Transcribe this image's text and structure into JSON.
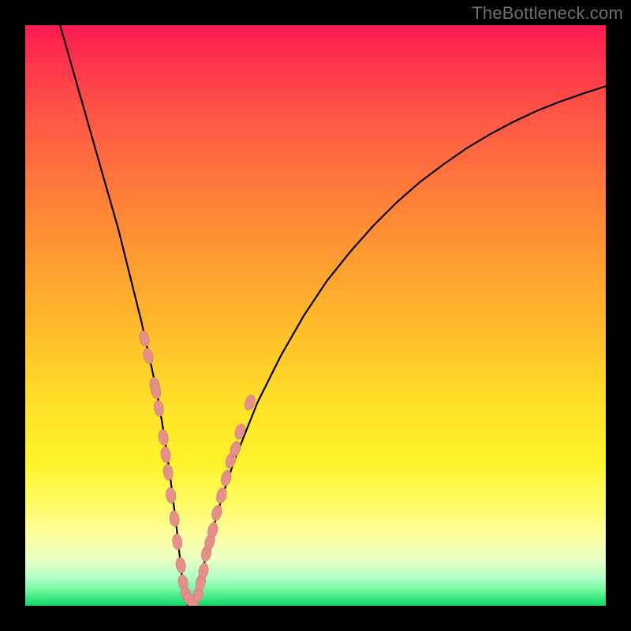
{
  "watermark": "TheBottleneck.com",
  "colors": {
    "frame": "#000000",
    "curve": "#000000",
    "marker_fill": "#e78f8a",
    "marker_stroke": "#c97a75"
  },
  "chart_data": {
    "type": "line",
    "title": "",
    "xlabel": "",
    "ylabel": "",
    "xlim": [
      0,
      100
    ],
    "ylim": [
      0,
      100
    ],
    "grid": false,
    "legend": false,
    "series": [
      {
        "name": "bottleneck-curve",
        "type": "line",
        "x": [
          6,
          8,
          10,
          12,
          14,
          16,
          18,
          20,
          22,
          23,
          24,
          25,
          26,
          27,
          28,
          29,
          30,
          32,
          34,
          36,
          38,
          40,
          44,
          48,
          52,
          56,
          60,
          64,
          68,
          72,
          76,
          80,
          84,
          88,
          92,
          96,
          100
        ],
        "y": [
          100,
          93,
          86,
          79,
          72,
          65,
          57,
          49,
          40,
          35,
          29,
          22,
          14,
          5,
          0,
          0,
          4,
          12,
          19,
          25,
          30,
          35,
          43,
          50,
          56,
          61,
          65.5,
          69.5,
          73,
          76,
          78.8,
          81.2,
          83.3,
          85.2,
          86.8,
          88.2,
          89.5
        ]
      },
      {
        "name": "measured-points-left",
        "type": "scatter",
        "x": [
          20.5,
          21.2,
          22.3,
          22.5,
          23.0,
          23.8,
          24.2,
          24.6,
          25.1,
          25.7,
          26.2,
          26.8,
          27.2,
          27.7,
          28.3,
          29.0
        ],
        "y": [
          46,
          43,
          38,
          37,
          34,
          29,
          26,
          23,
          19,
          15,
          11,
          7,
          4,
          2,
          1,
          0
        ]
      },
      {
        "name": "measured-points-right",
        "type": "scatter",
        "x": [
          29.8,
          30.2,
          30.7,
          31.2,
          31.8,
          32.3,
          33.0,
          33.8,
          34.6,
          35.4,
          36.2,
          37.0,
          38.7
        ],
        "y": [
          2,
          4,
          6,
          9,
          11,
          13,
          16,
          19,
          22,
          25,
          27,
          30,
          35
        ]
      }
    ]
  }
}
